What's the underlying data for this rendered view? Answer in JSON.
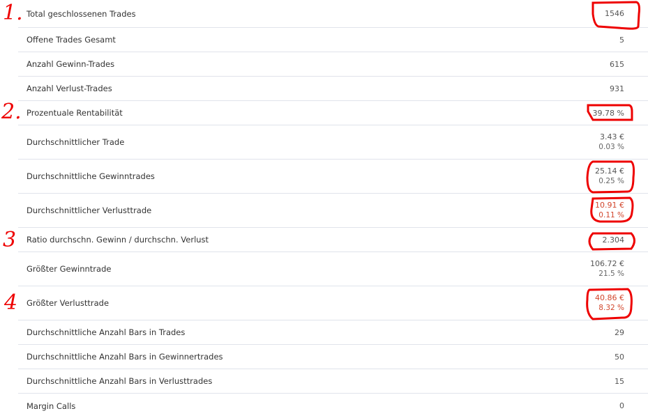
{
  "rows": [
    {
      "label": "Total geschlossenen Trades",
      "value": "1546"
    },
    {
      "label": "Offene Trades Gesamt",
      "value": "5"
    },
    {
      "label": "Anzahl Gewinn-Trades",
      "value": "615"
    },
    {
      "label": "Anzahl Verlust-Trades",
      "value": "931"
    },
    {
      "label": "Prozentuale Rentabilität",
      "value": "39.78 %"
    },
    {
      "label": "Durchschnittlicher Trade",
      "value": "3.43 €",
      "sub": "0.03 %"
    },
    {
      "label": "Durchschnittliche Gewinntrades",
      "value": "25.14 €",
      "sub": "0.25 %"
    },
    {
      "label": "Durchschnittlicher Verlusttrade",
      "value": "10.91 €",
      "sub": "0.11 %",
      "negative": true
    },
    {
      "label": "Ratio durchschn. Gewinn / durchschn. Verlust",
      "value": "2.304"
    },
    {
      "label": "Größter Gewinntrade",
      "value": "106.72 €",
      "sub": "21.5 %"
    },
    {
      "label": "Größter Verlusttrade",
      "value": "40.86 €",
      "sub": "8.32 %",
      "negative": true
    },
    {
      "label": "Durchschnittliche Anzahl Bars in Trades",
      "value": "29"
    },
    {
      "label": "Durchschnittliche Anzahl Bars in Gewinnertrades",
      "value": "50"
    },
    {
      "label": "Durchschnittliche Anzahl Bars in Verlusttrades",
      "value": "15"
    },
    {
      "label": "Margin Calls",
      "value": "0"
    }
  ],
  "annotations": {
    "m1": "1.",
    "m2": "2.",
    "m3": "3",
    "m4": "4",
    "color": "#e00000"
  },
  "colors": {
    "negative": "#d2462c",
    "text": "#333333",
    "divider": "#e0e3eb"
  }
}
